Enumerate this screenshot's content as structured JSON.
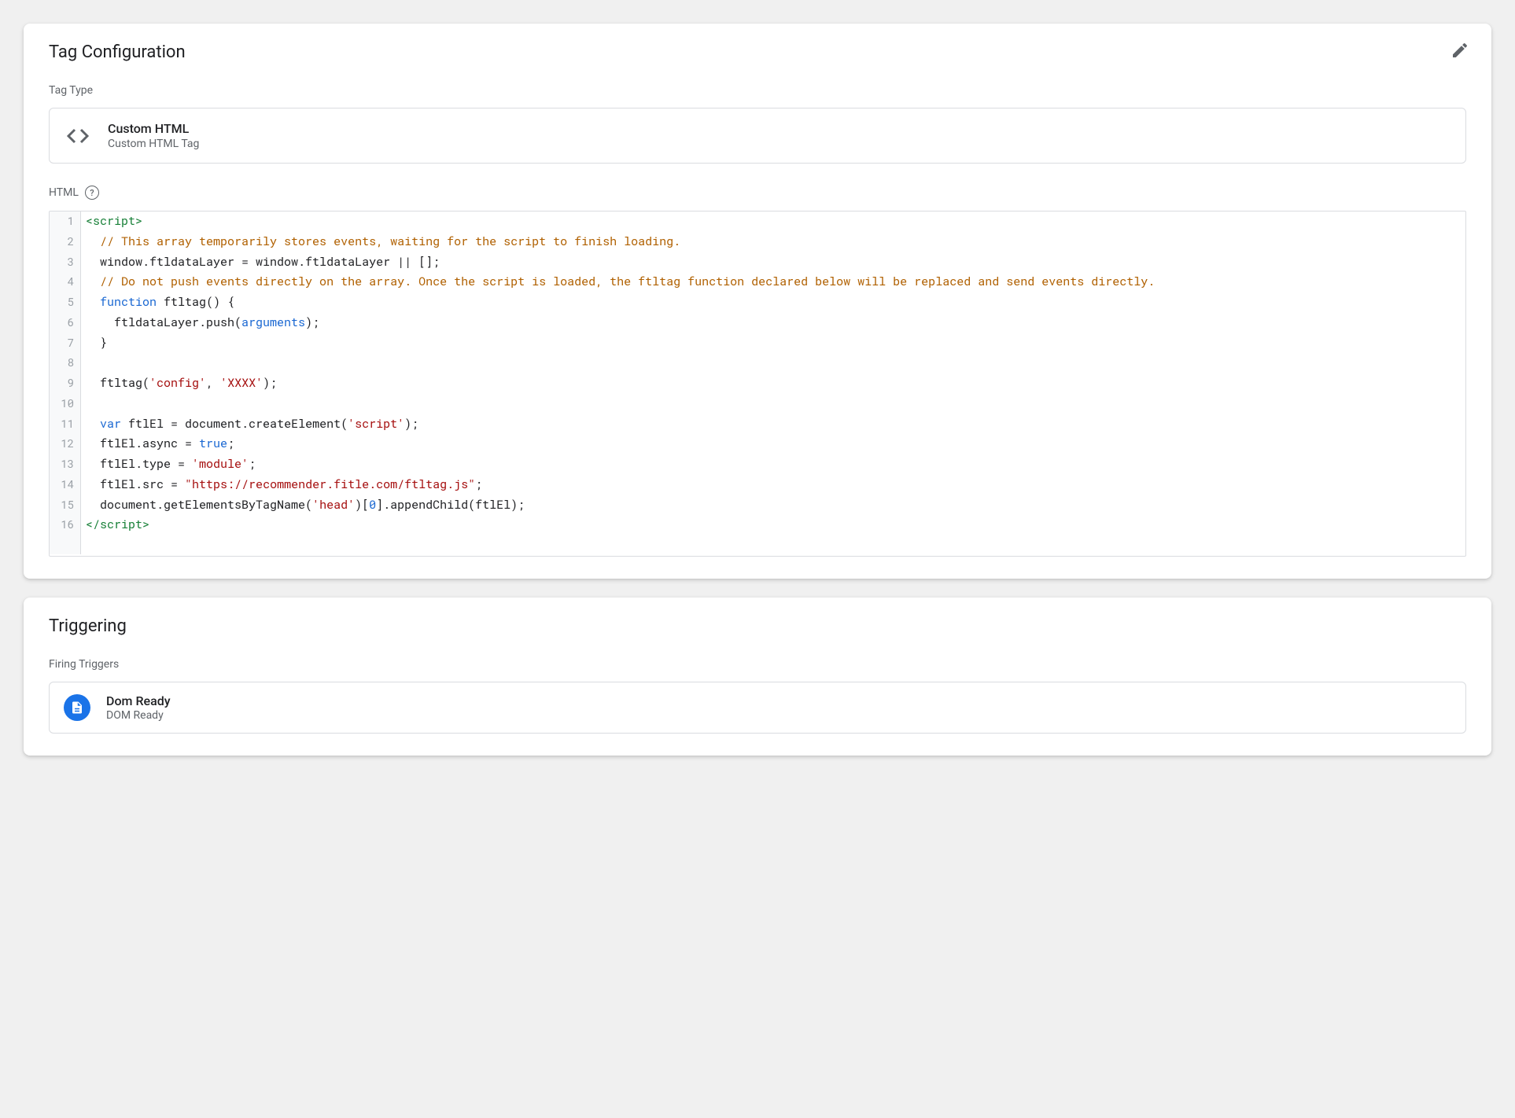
{
  "tagConfig": {
    "title": "Tag Configuration",
    "tagTypeLabel": "Tag Type",
    "tagType": {
      "title": "Custom HTML",
      "subtitle": "Custom HTML Tag"
    },
    "htmlLabel": "HTML",
    "code": {
      "lines": [
        {
          "n": 1,
          "tokens": [
            {
              "c": "tag",
              "t": "<script>"
            }
          ]
        },
        {
          "n": 2,
          "tokens": [
            {
              "c": "plain",
              "t": "  "
            },
            {
              "c": "comment",
              "t": "// This array temporarily stores events, waiting for the script to finish loading."
            }
          ]
        },
        {
          "n": 3,
          "tokens": [
            {
              "c": "plain",
              "t": "  window.ftldataLayer = window.ftldataLayer || [];"
            }
          ]
        },
        {
          "n": 4,
          "tokens": [
            {
              "c": "plain",
              "t": "  "
            },
            {
              "c": "comment",
              "t": "// Do not push events directly on the array. Once the script is loaded, the ftltag function declared below will be replaced and send events directly."
            }
          ]
        },
        {
          "n": 5,
          "tokens": [
            {
              "c": "plain",
              "t": "  "
            },
            {
              "c": "keyword",
              "t": "function"
            },
            {
              "c": "plain",
              "t": " "
            },
            {
              "c": "funcname",
              "t": "ftltag"
            },
            {
              "c": "plain",
              "t": "() {"
            }
          ]
        },
        {
          "n": 6,
          "tokens": [
            {
              "c": "plain",
              "t": "    ftldataLayer.push("
            },
            {
              "c": "builtin",
              "t": "arguments"
            },
            {
              "c": "plain",
              "t": ");"
            }
          ]
        },
        {
          "n": 7,
          "tokens": [
            {
              "c": "plain",
              "t": "  }"
            }
          ]
        },
        {
          "n": 8,
          "tokens": [
            {
              "c": "plain",
              "t": ""
            }
          ]
        },
        {
          "n": 9,
          "tokens": [
            {
              "c": "plain",
              "t": "  ftltag("
            },
            {
              "c": "string",
              "t": "'config'"
            },
            {
              "c": "plain",
              "t": ", "
            },
            {
              "c": "string",
              "t": "'XXXX'"
            },
            {
              "c": "plain",
              "t": ");"
            }
          ]
        },
        {
          "n": 10,
          "tokens": [
            {
              "c": "plain",
              "t": ""
            }
          ]
        },
        {
          "n": 11,
          "tokens": [
            {
              "c": "plain",
              "t": "  "
            },
            {
              "c": "keyword",
              "t": "var"
            },
            {
              "c": "plain",
              "t": " ftlEl = document.createElement("
            },
            {
              "c": "string",
              "t": "'script'"
            },
            {
              "c": "plain",
              "t": ");"
            }
          ]
        },
        {
          "n": 12,
          "tokens": [
            {
              "c": "plain",
              "t": "  ftlEl.async = "
            },
            {
              "c": "keyword",
              "t": "true"
            },
            {
              "c": "plain",
              "t": ";"
            }
          ]
        },
        {
          "n": 13,
          "tokens": [
            {
              "c": "plain",
              "t": "  ftlEl.type = "
            },
            {
              "c": "string",
              "t": "'module'"
            },
            {
              "c": "plain",
              "t": ";"
            }
          ]
        },
        {
          "n": 14,
          "tokens": [
            {
              "c": "plain",
              "t": "  ftlEl.src = "
            },
            {
              "c": "string",
              "t": "\"https://recommender.fitle.com/ftltag.js\""
            },
            {
              "c": "plain",
              "t": ";"
            }
          ]
        },
        {
          "n": 15,
          "tokens": [
            {
              "c": "plain",
              "t": "  document.getElementsByTagName("
            },
            {
              "c": "string",
              "t": "'head'"
            },
            {
              "c": "plain",
              "t": ")["
            },
            {
              "c": "number",
              "t": "0"
            },
            {
              "c": "plain",
              "t": "].appendChild(ftlEl);"
            }
          ]
        },
        {
          "n": 16,
          "tokens": [
            {
              "c": "tag",
              "t": "</"
            },
            {
              "c": "tag",
              "t": "script>"
            }
          ]
        }
      ]
    }
  },
  "triggering": {
    "title": "Triggering",
    "firingLabel": "Firing Triggers",
    "trigger": {
      "title": "Dom Ready",
      "subtitle": "DOM Ready"
    }
  }
}
